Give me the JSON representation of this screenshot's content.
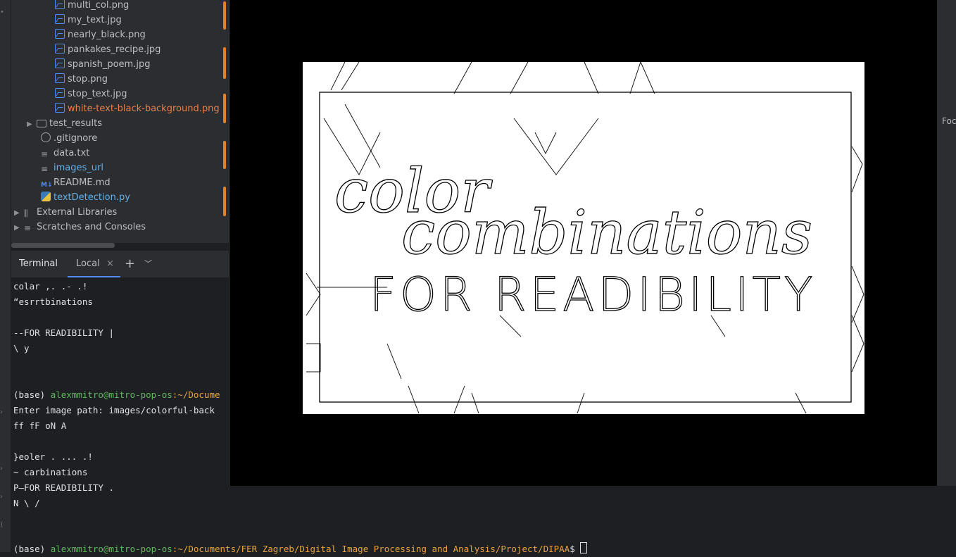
{
  "project_tree": {
    "items": [
      {
        "label": "multi_col.png",
        "icon": "image-file-icon",
        "kind": "file"
      },
      {
        "label": "my_text.jpg",
        "icon": "image-file-icon",
        "kind": "file"
      },
      {
        "label": "nearly_black.png",
        "icon": "image-file-icon",
        "kind": "file"
      },
      {
        "label": "pankakes_recipe.jpg",
        "icon": "image-file-icon",
        "kind": "file"
      },
      {
        "label": "spanish_poem.jpg",
        "icon": "image-file-icon",
        "kind": "file"
      },
      {
        "label": "stop.png",
        "icon": "image-file-icon",
        "kind": "file"
      },
      {
        "label": "stop_text.jpg",
        "icon": "image-file-icon",
        "kind": "file"
      },
      {
        "label": "white-text-black-background.png",
        "icon": "image-file-icon",
        "kind": "file",
        "color": "#e8804a"
      },
      {
        "label": "test_results",
        "icon": "folder-icon",
        "kind": "folder"
      },
      {
        "label": ".gitignore",
        "icon": "ignore-file-icon",
        "kind": "file"
      },
      {
        "label": "data.txt",
        "icon": "text-file-icon",
        "kind": "file"
      },
      {
        "label": "images_url",
        "icon": "text-file-icon",
        "kind": "file",
        "color": "#5fb0e8"
      },
      {
        "label": "README.md",
        "icon": "markdown-file-icon",
        "kind": "file"
      },
      {
        "label": "textDetection.py",
        "icon": "python-file-icon",
        "kind": "file",
        "color": "#5fb0e8"
      },
      {
        "label": "External Libraries",
        "icon": "library-icon",
        "kind": "node"
      },
      {
        "label": "Scratches and Consoles",
        "icon": "scratches-icon",
        "kind": "node"
      }
    ]
  },
  "terminal": {
    "title": "Terminal",
    "tab_local": "Local",
    "lines": [
      "colar ,. .- .!",
      "“esrrtbinations",
      "",
      "--FOR READIBILITY |",
      "\\ y",
      "",
      "",
      "",
      "Enter image path: images/colorful-back",
      "ff fF oN A",
      "",
      "}eoler . ... .!",
      "~ carbinations",
      "P—FOR READIBILITY .",
      "N \\ /",
      "",
      ""
    ],
    "prompt1": {
      "env": "(base) ",
      "user": "alexmmitro@mitro-pop-os",
      "path": ":~/Docume"
    },
    "prompt2": {
      "env": "(base) ",
      "user": "alexmmitro@mitro-pop-os",
      "path": ":~/Documents/FER Zagreb/Digital Image Processing and Analysis/Project/DIPAA",
      "end": "$ "
    }
  },
  "viewer": {
    "text_line1": "color",
    "text_line2": "combinations",
    "text_line3": "FOR READIBILITY"
  },
  "right_panel": {
    "label": "Foc"
  }
}
